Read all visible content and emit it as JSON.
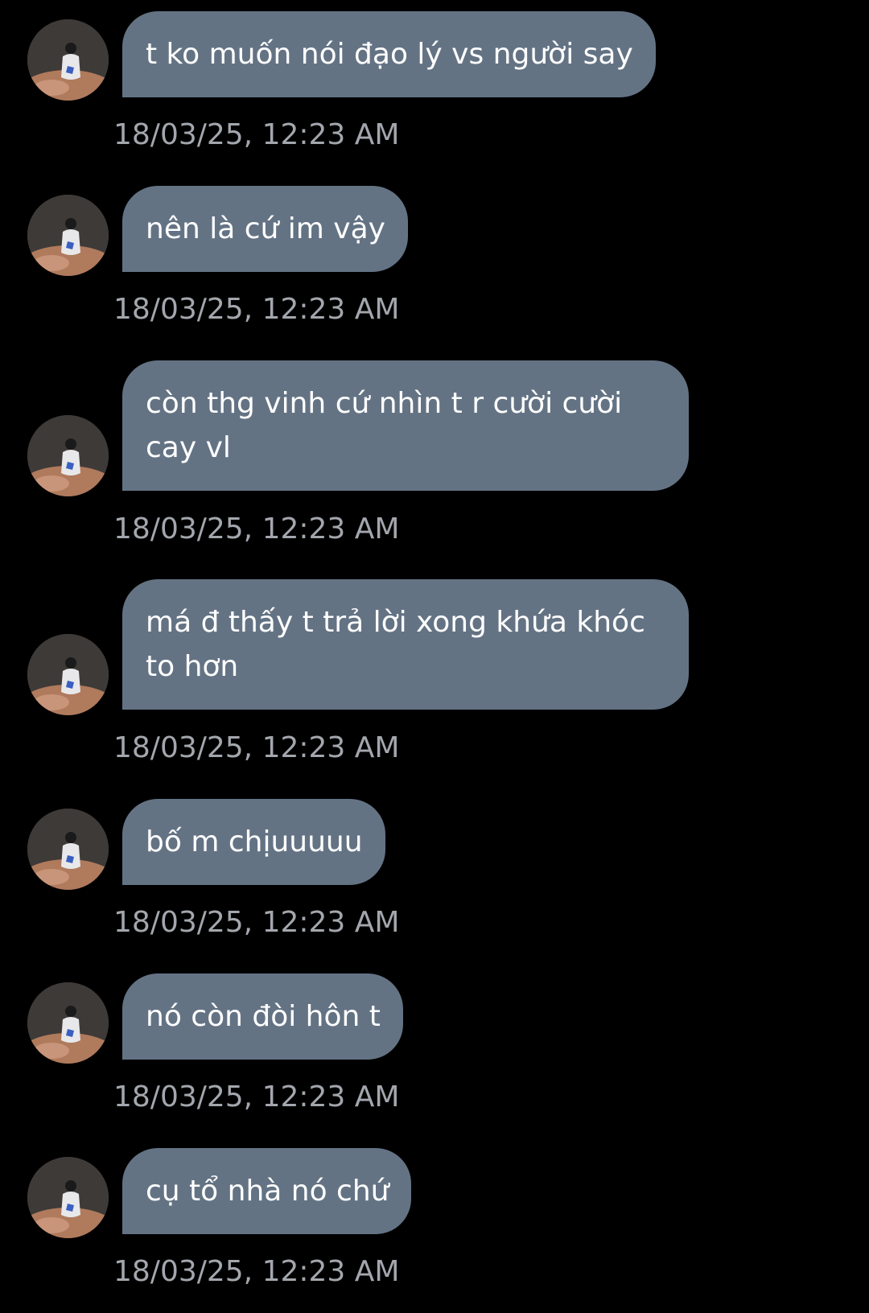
{
  "colors": {
    "background": "#000000",
    "bubble": "#647384",
    "bubble_text": "#ffffff",
    "timestamp": "#a3a7ad"
  },
  "avatar_icon": "user-avatar-photo",
  "messages": [
    {
      "text": "t ko muốn nói đạo lý vs người say",
      "time": "18/03/25, 12:23 AM"
    },
    {
      "text": "nên là cứ im vậy",
      "time": "18/03/25, 12:23 AM"
    },
    {
      "text": "còn thg vinh cứ nhìn t r cười cười cay vl",
      "time": "18/03/25, 12:23 AM"
    },
    {
      "text": "má đ thấy t trả lời xong khứa khóc to hơn",
      "time": "18/03/25, 12:23 AM"
    },
    {
      "text": "bố m chịuuuuu",
      "time": "18/03/25, 12:23 AM"
    },
    {
      "text": "nó còn đòi hôn t",
      "time": "18/03/25, 12:23 AM"
    },
    {
      "text": "cụ tổ nhà nó chứ",
      "time": "18/03/25, 12:23 AM"
    }
  ]
}
